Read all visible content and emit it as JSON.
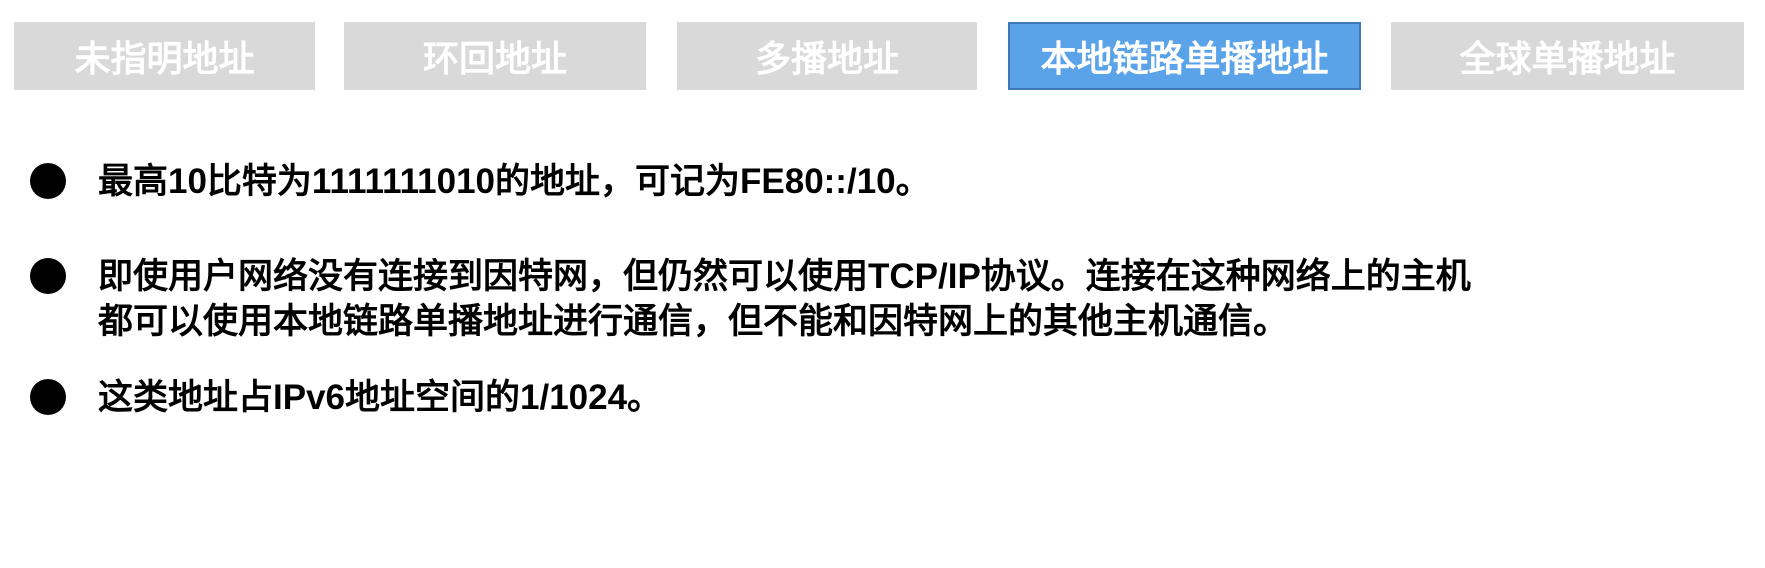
{
  "tabs": [
    {
      "label": "未指明地址",
      "active": false
    },
    {
      "label": "环回地址",
      "active": false
    },
    {
      "label": "多播地址",
      "active": false
    },
    {
      "label": "本地链路单播地址",
      "active": true
    },
    {
      "label": "全球单播地址",
      "active": false
    }
  ],
  "colors": {
    "tab_inactive": "#d9d9d9",
    "tab_active": "#5ba3e8"
  },
  "bullets": [
    {
      "lines": [
        "最高10比特为1111111010的地址，可记为FE80::/10。"
      ]
    },
    {
      "lines": [
        "即使用户网络没有连接到因特网，但仍然可以使用TCP/IP协议。连接在这种网络上的主机",
        "都可以使用本地链路单播地址进行通信，但不能和因特网上的其他主机通信。"
      ]
    },
    {
      "lines": [
        "这类地址占IPv6地址空间的1/1024。"
      ]
    }
  ]
}
